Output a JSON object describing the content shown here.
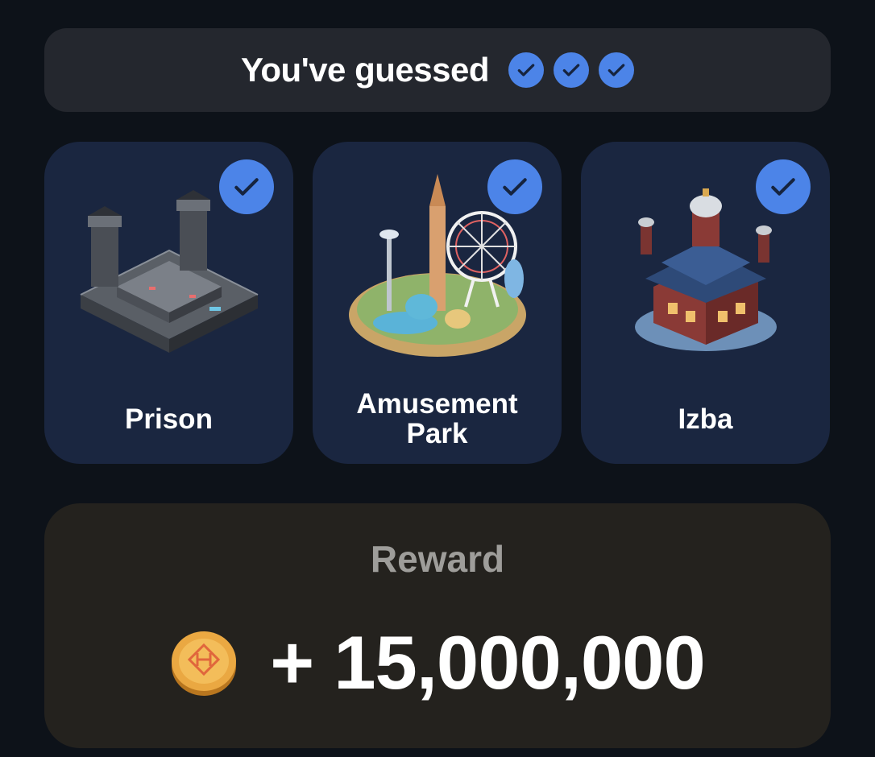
{
  "header": {
    "title": "You've guessed",
    "checks": [
      {
        "icon": "check-icon"
      },
      {
        "icon": "check-icon"
      },
      {
        "icon": "check-icon"
      }
    ]
  },
  "cards": [
    {
      "label": "Prison",
      "icon": "prison-illustration",
      "checked": true
    },
    {
      "label": "Amusement\nPark",
      "icon": "amusement-park-illustration",
      "checked": true
    },
    {
      "label": "Izba",
      "icon": "izba-illustration",
      "checked": true
    }
  ],
  "reward": {
    "title": "Reward",
    "amount": "+ 15,000,000",
    "icon": "coin-icon"
  },
  "colors": {
    "background": "#0d1219",
    "header_bg": "#24272e",
    "card_bg": "#1a2640",
    "check_blue": "#4c84e8",
    "reward_bg": "#24221e",
    "reward_title": "#9e9d9a",
    "coin_gold": "#e8a63a"
  }
}
